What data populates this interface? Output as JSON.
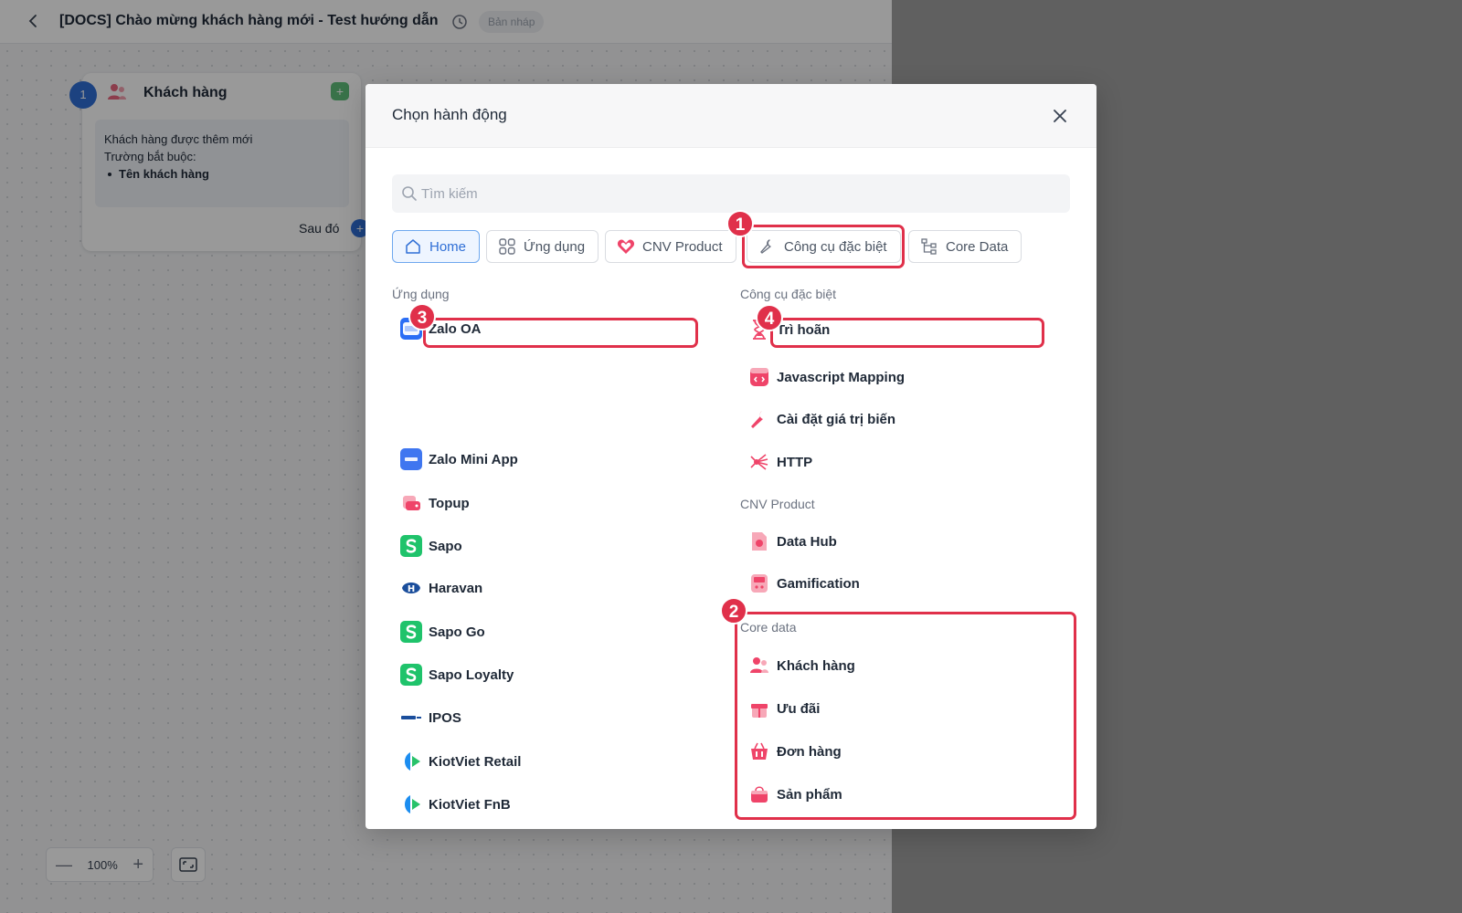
{
  "editor": {
    "title": "[DOCS] Chào mừng khách hàng mới - Test hướng dẫn",
    "status_badge": "Bản nháp",
    "node": {
      "step": "1",
      "title": "Khách hàng",
      "trigger": "Khách hàng được thêm mới",
      "required_label": "Trường bắt buộc:",
      "required_field": "Tên khách hàng",
      "next_label": "Sau đó"
    },
    "zoom": "100%"
  },
  "modal": {
    "title": "Chọn hành động",
    "search_placeholder": "Tìm kiếm",
    "tabs": [
      {
        "label": "Home",
        "icon": "home-icon",
        "active": true
      },
      {
        "label": "Ứng dụng",
        "icon": "grid-icon",
        "active": false
      },
      {
        "label": "CNV Product",
        "icon": "heart-icon",
        "active": false
      },
      {
        "label": "Công cụ đặc biệt",
        "icon": "wrench-icon",
        "active": false
      },
      {
        "label": "Core Data",
        "icon": "tree-icon",
        "active": false
      }
    ],
    "apps_section": {
      "label": "Ứng dụng",
      "items": [
        {
          "label": "Zalo OA",
          "icon": "zalo-oa-icon"
        },
        {
          "label": "Zalo Mini App",
          "icon": "zalo-mini-app-icon"
        },
        {
          "label": "Topup",
          "icon": "topup-icon"
        },
        {
          "label": "Sapo",
          "icon": "sapo-icon"
        },
        {
          "label": "Haravan",
          "icon": "haravan-icon"
        },
        {
          "label": "Sapo Go",
          "icon": "sapo-go-icon"
        },
        {
          "label": "Sapo Loyalty",
          "icon": "sapo-loyalty-icon"
        },
        {
          "label": "IPOS",
          "icon": "ipos-icon"
        },
        {
          "label": "KiotViet Retail",
          "icon": "kiotviet-retail-icon"
        },
        {
          "label": "KiotViet FnB",
          "icon": "kiotviet-fnb-icon"
        }
      ]
    },
    "tools_section": {
      "label": "Công cụ đặc biệt",
      "items": [
        {
          "label": "Trì hoãn",
          "icon": "hourglass-icon"
        },
        {
          "label": "Javascript Mapping",
          "icon": "code-icon"
        },
        {
          "label": "Cài đặt giá trị biến",
          "icon": "wrench-icon"
        },
        {
          "label": "HTTP",
          "icon": "http-icon"
        }
      ]
    },
    "product_section": {
      "label": "CNV Product",
      "items": [
        {
          "label": "Data Hub",
          "icon": "data-hub-icon"
        },
        {
          "label": "Gamification",
          "icon": "gamification-icon"
        }
      ]
    },
    "core_section": {
      "label": "Core data",
      "items": [
        {
          "label": "Khách hàng",
          "icon": "users-icon"
        },
        {
          "label": "Ưu đãi",
          "icon": "gift-icon"
        },
        {
          "label": "Đơn hàng",
          "icon": "basket-icon"
        },
        {
          "label": "Sản phẩm",
          "icon": "bag-icon"
        }
      ]
    }
  },
  "annotations": [
    "1",
    "2",
    "3",
    "4"
  ],
  "colors": {
    "highlight": "#e0304a",
    "primary": "#2f6fd6",
    "brand_pink": "#ef4469"
  }
}
